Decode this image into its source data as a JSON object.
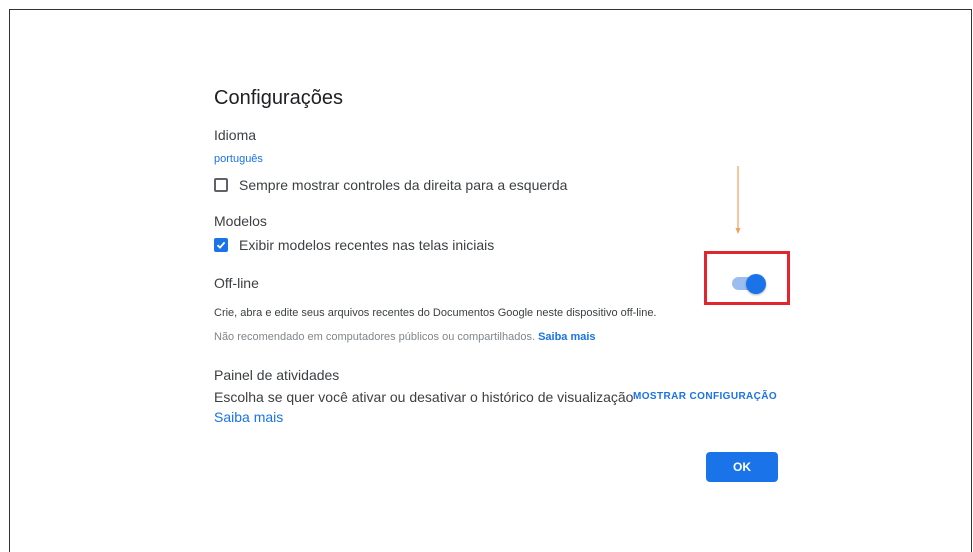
{
  "dialog": {
    "title": "Configurações",
    "language": {
      "heading": "Idioma",
      "current": "português",
      "rtl_checkbox_label": "Sempre mostrar controles da direita para a esquerda",
      "rtl_checked": false
    },
    "templates": {
      "heading": "Modelos",
      "checkbox_label": "Exibir modelos recentes nas telas iniciais",
      "checked": true
    },
    "offline": {
      "heading": "Off-line",
      "description": "Crie, abra e edite seus arquivos recentes do Documentos Google neste dispositivo off-line.",
      "warning": "Não recomendado em computadores públicos ou compartilhados.",
      "learn_more": "Saiba mais",
      "enabled": true
    },
    "activity": {
      "heading": "Painel de atividades",
      "description": "Escolha se quer você ativar ou desativar o histórico de visualização",
      "show_settings": "MOSTRAR CONFIGURAÇÃO",
      "learn_more": "Saiba mais"
    },
    "ok_label": "OK"
  },
  "colors": {
    "accent": "#1a73e8",
    "highlight": "#e2262e",
    "arrow": "#f0a05a"
  }
}
